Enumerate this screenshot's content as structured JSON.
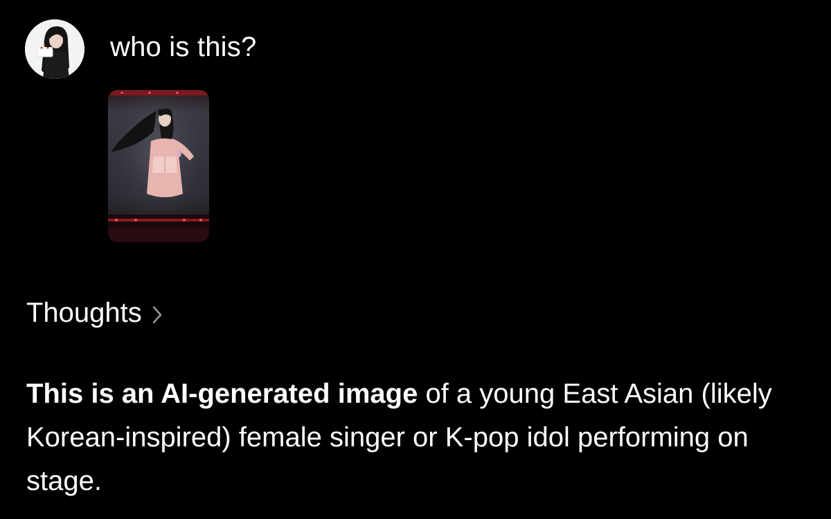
{
  "user_message": {
    "text": "who is this?",
    "avatar_icon": "user-avatar"
  },
  "attachment": {
    "icon": "photo-thumbnail"
  },
  "thoughts": {
    "label": "Thoughts",
    "chevron_icon": "chevron-right-icon"
  },
  "response": {
    "bold_text": "This is an AI-generated image",
    "rest_text": " of a young East Asian (likely Korean-inspired) female singer or K-pop idol performing on stage."
  },
  "colors": {
    "background": "#000000",
    "text": "#ffffff",
    "chevron": "#9a9a9a"
  }
}
